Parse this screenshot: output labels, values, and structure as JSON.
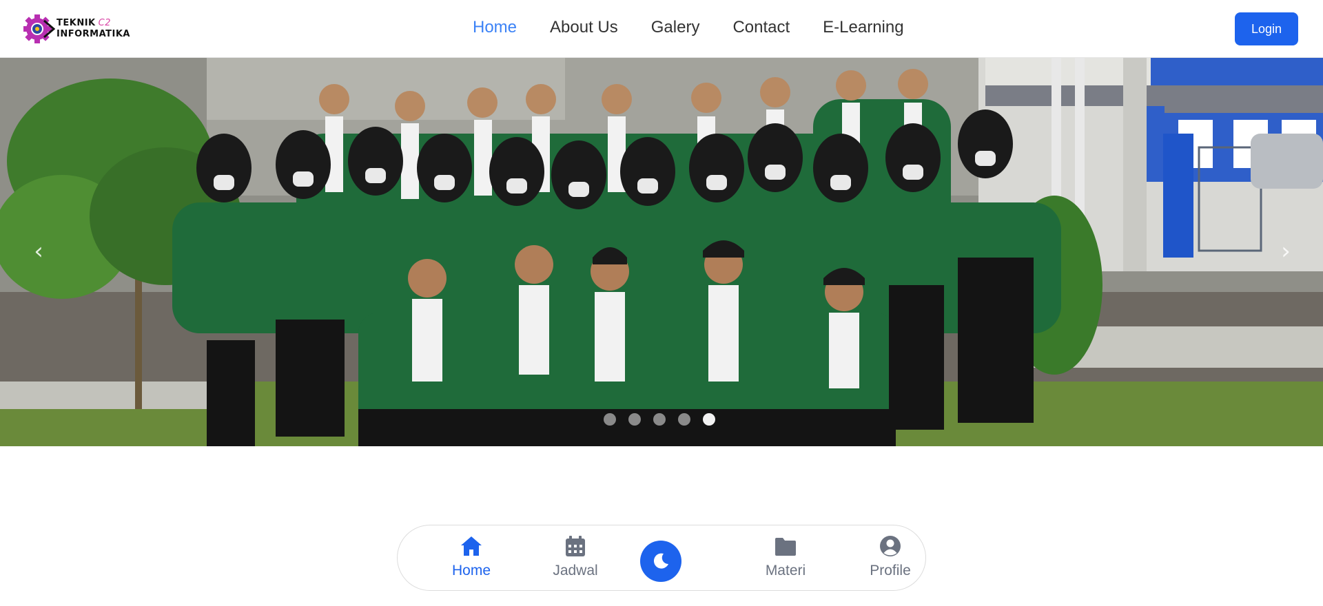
{
  "brand": {
    "line1": "TEKNIK",
    "line1_suffix": "C2",
    "line2": "INFORMATIKA"
  },
  "nav": {
    "items": [
      {
        "label": "Home",
        "active": true
      },
      {
        "label": "About Us",
        "active": false
      },
      {
        "label": "Galery",
        "active": false
      },
      {
        "label": "Contact",
        "active": false
      },
      {
        "label": "E-Learning",
        "active": false
      }
    ],
    "login_label": "Login"
  },
  "carousel": {
    "prev_glyph": "‹",
    "next_glyph": "›",
    "slide_count": 5,
    "active_index": 4
  },
  "bottom_nav": {
    "items": {
      "home": "Home",
      "jadwal": "Jadwal",
      "materi": "Materi",
      "profile": "Profile"
    },
    "center_icon": "moon-icon"
  },
  "colors": {
    "accent": "#1d63ed",
    "nav_active": "#3b82f6",
    "jacket_green": "#1f6b3a"
  }
}
